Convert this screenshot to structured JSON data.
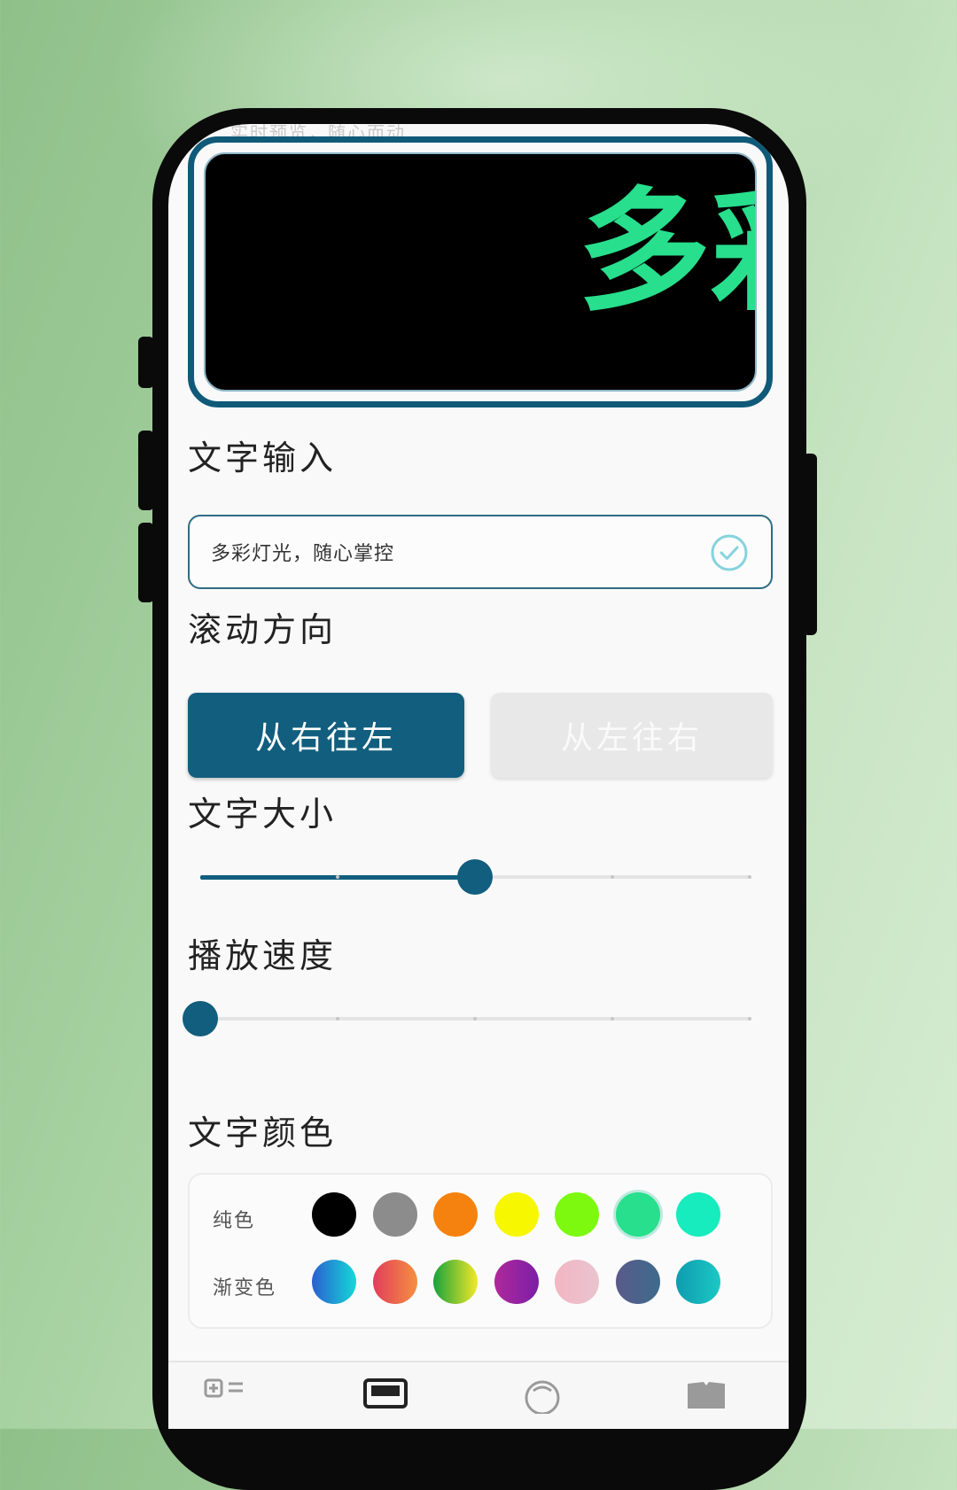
{
  "status_text": "实时预览，随心而动",
  "preview": {
    "text": "多彩",
    "color": "#27df8c"
  },
  "text_input": {
    "title": "文字输入",
    "value": "多彩灯光，随心掌控"
  },
  "direction": {
    "title": "滚动方向",
    "options": [
      {
        "label": "从右往左",
        "selected": true
      },
      {
        "label": "从左往右",
        "selected": false
      }
    ]
  },
  "text_size": {
    "title": "文字大小",
    "value_fraction": 0.5,
    "steps": 4
  },
  "play_speed": {
    "title": "播放速度",
    "value_fraction": 0.0,
    "steps": 4
  },
  "text_color": {
    "title": "文字颜色",
    "solid_label": "纯色",
    "gradient_label": "渐变色",
    "solid_colors": [
      "#000000",
      "#8c8c8c",
      "#f5820e",
      "#f7f700",
      "#7cf90f",
      "#27df8c",
      "#16ecbd"
    ],
    "selected_solid_index": 5,
    "gradient_colors": [
      [
        "#2a5fcf",
        "#15d8d8"
      ],
      [
        "#e23d5a",
        "#f59042"
      ],
      [
        "#18a23c",
        "#f3e828"
      ],
      [
        "#b0289a",
        "#7a1fa6"
      ],
      [
        "#f2b6c2",
        "#e9c4d0"
      ],
      [
        "#5a5a8a",
        "#3d6b8c"
      ],
      [
        "#0e9cb0",
        "#1cc8c4"
      ]
    ]
  },
  "icons": [
    "check-circle-icon",
    "grid-icon",
    "monitor-icon",
    "circle-icon",
    "book-icon"
  ]
}
